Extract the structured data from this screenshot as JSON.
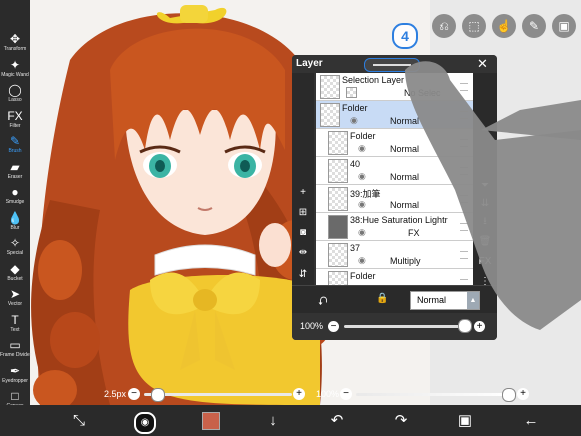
{
  "toolbar": {
    "tools": [
      {
        "label": "Transform",
        "icon": "move-icon",
        "glyph": "✥"
      },
      {
        "label": "Magic Wand",
        "icon": "magic-wand-icon",
        "glyph": "✦"
      },
      {
        "label": "Lasso",
        "icon": "lasso-icon",
        "glyph": "◯"
      },
      {
        "label": "Filter",
        "icon": "filter-icon",
        "glyph": "FX"
      },
      {
        "label": "Brush",
        "icon": "brush-icon",
        "glyph": "✎"
      },
      {
        "label": "Eraser",
        "icon": "eraser-icon",
        "glyph": "▰"
      },
      {
        "label": "Smudge",
        "icon": "smudge-icon",
        "glyph": "●"
      },
      {
        "label": "Blur",
        "icon": "blur-icon",
        "glyph": "💧"
      },
      {
        "label": "Special",
        "icon": "special-brush-icon",
        "glyph": "✧"
      },
      {
        "label": "Bucket",
        "icon": "bucket-icon",
        "glyph": "◆"
      },
      {
        "label": "Vector",
        "icon": "vector-icon",
        "glyph": "➤"
      },
      {
        "label": "Text",
        "icon": "text-icon",
        "glyph": "T"
      },
      {
        "label": "Frame Divider",
        "icon": "frame-divider-icon",
        "glyph": "▭"
      },
      {
        "label": "Eyedropper",
        "icon": "eyedropper-icon",
        "glyph": "✒"
      },
      {
        "label": "Canvas",
        "icon": "canvas-icon",
        "glyph": "□"
      }
    ],
    "active_tool": "Brush"
  },
  "top_buttons": [
    {
      "icon": "undo-stack-icon",
      "glyph": "⎌"
    },
    {
      "icon": "selection-icon",
      "glyph": "⬚"
    },
    {
      "icon": "touch-icon",
      "glyph": "☝"
    },
    {
      "icon": "pen-icon",
      "glyph": "✎"
    },
    {
      "icon": "image-icon",
      "glyph": "▣"
    }
  ],
  "tutorial_step": "4",
  "layer_panel": {
    "title": "Layer",
    "close_glyph": "✕",
    "layers": [
      {
        "name": "Selection Layer",
        "mode": "No Selec",
        "kind": "selection"
      },
      {
        "name": "Folder",
        "mode": "Normal",
        "kind": "folder",
        "selected": true
      },
      {
        "name": "Folder",
        "mode": "Normal",
        "kind": "folder"
      },
      {
        "name": "40",
        "mode": "Normal",
        "kind": "layer"
      },
      {
        "name": "39:加筆",
        "mode": "Normal",
        "kind": "layer"
      },
      {
        "name": "38:Hue Saturation Lightr",
        "mode": "FX",
        "kind": "filter"
      },
      {
        "name": "37",
        "mode": "Multiply",
        "kind": "layer"
      },
      {
        "name": "Folder",
        "mode": "",
        "kind": "folder"
      }
    ],
    "side_buttons": [
      {
        "icon": "add-layer-icon",
        "glyph": "+"
      },
      {
        "icon": "add-layer-square-icon",
        "glyph": "⊞"
      },
      {
        "icon": "camera-icon",
        "glyph": "◙"
      },
      {
        "icon": "flip-horizontal-icon",
        "glyph": "⇹"
      },
      {
        "icon": "flip-vertical-icon",
        "glyph": "⇵"
      }
    ],
    "right_buttons": [
      {
        "icon": "move-down-icon",
        "glyph": "⏷"
      },
      {
        "icon": "merge-icon",
        "glyph": "⇊"
      },
      {
        "icon": "download-icon",
        "glyph": "⭳"
      },
      {
        "icon": "trash-icon",
        "glyph": "🗑"
      },
      {
        "icon": "fx-icon",
        "glyph": "FX"
      },
      {
        "icon": "more-icon",
        "glyph": "⋮"
      }
    ],
    "blend_mode": "Normal",
    "opacity_label": "100%",
    "opacity": 1.0
  },
  "brush": {
    "size_label": "2.5px",
    "size_fraction": 0.02,
    "opacity_label": "100%",
    "opacity": 1.0,
    "color": "#c8614a"
  },
  "bottom_bar": [
    {
      "icon": "transform-icon",
      "glyph": "⤡"
    },
    {
      "icon": "brush-preset-icon",
      "glyph": "◉"
    },
    {
      "icon": "color-swatch-icon",
      "glyph": ""
    },
    {
      "icon": "download-arrow-icon",
      "glyph": "↓"
    },
    {
      "icon": "undo-icon",
      "glyph": "↶"
    },
    {
      "icon": "redo-icon",
      "glyph": "↷"
    },
    {
      "icon": "layers-icon",
      "glyph": "▣"
    },
    {
      "icon": "back-icon",
      "glyph": "←"
    }
  ]
}
